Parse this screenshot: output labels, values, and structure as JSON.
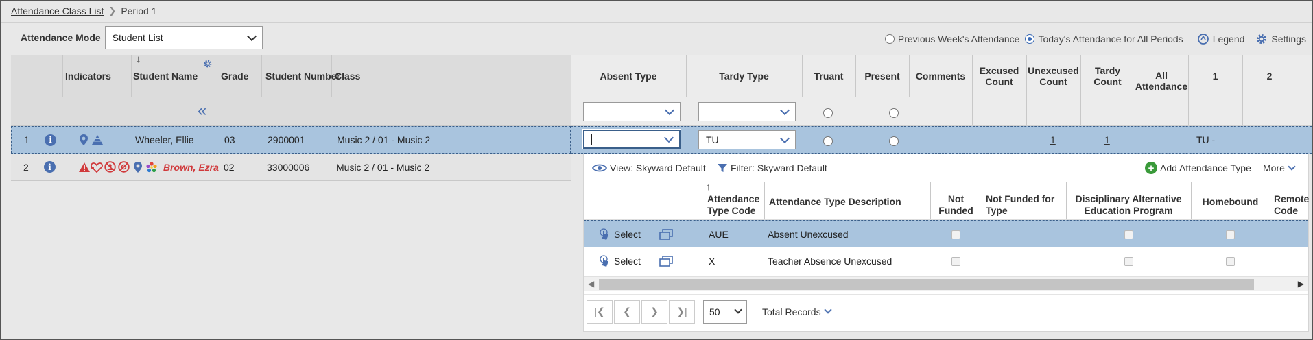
{
  "breadcrumb": {
    "parent": "Attendance Class List",
    "current": "Period 1"
  },
  "mode": {
    "label": "Attendance Mode",
    "selected": "Student List"
  },
  "options": {
    "previous_week": "Previous Week's Attendance",
    "today_all": "Today's Attendance for All Periods",
    "legend": "Legend",
    "settings": "Settings",
    "selected_option": "today_all"
  },
  "left_headers": {
    "indicators": "Indicators",
    "student_name": "Student Name",
    "grade": "Grade",
    "student_number": "Student Number",
    "class": "Class"
  },
  "students": [
    {
      "row": "1",
      "name": "Wheeler, Ellie",
      "grade": "03",
      "number": "2900001",
      "class": "Music 2 / 01 - Music 2"
    },
    {
      "row": "2",
      "name": "Brown, Ezra",
      "grade": "02",
      "number": "33000006",
      "class": "Music 2 / 01 - Music 2"
    }
  ],
  "right_headers": {
    "absent_type": "Absent Type",
    "tardy_type": "Tardy Type",
    "truant": "Truant",
    "present": "Present",
    "comments": "Comments",
    "excused_count": "Excused Count",
    "unexcused_count": "Unexcused Count",
    "tardy_count": "Tardy Count",
    "all_attendance": "All Attendance",
    "p1": "1",
    "p2": "2"
  },
  "row1_values": {
    "absent_type": "",
    "tardy_type": "TU",
    "unexcused_count": "1",
    "tardy_count": "1",
    "p1": "TU -"
  },
  "lookup": {
    "view": "View: Skyward Default",
    "filter": "Filter: Skyward Default",
    "add": "Add Attendance Type",
    "more": "More",
    "headers": {
      "code": "Attendance Type Code",
      "description": "Attendance Type Description",
      "not_funded": "Not Funded",
      "not_funded_type": "Not Funded for Type",
      "daep": "Disciplinary Alternative Education Program",
      "homebound": "Homebound",
      "remote": "Remote Code"
    },
    "select_label": "Select",
    "rows": [
      {
        "code": "AUE",
        "description": "Absent Unexcused"
      },
      {
        "code": "X",
        "description": "Teacher Absence Unexcused"
      }
    ],
    "page_size": "50",
    "total_records": "Total Records"
  },
  "colors": {
    "accent": "#4a6fb0",
    "selected_row": "#a9c4de",
    "alert_red": "#d0393b"
  }
}
